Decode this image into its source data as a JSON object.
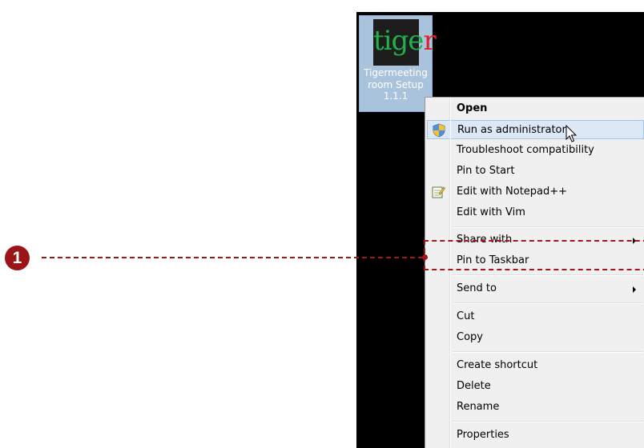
{
  "desktop_icon": {
    "logo_text_part1": "ti",
    "logo_text_part2": "ge",
    "logo_text_part3": "r",
    "caption_line1": "Tigermeeting",
    "caption_line2": "room Setup",
    "caption_line3": "1.1.1"
  },
  "context_menu": {
    "items": [
      {
        "label": "Open"
      },
      {
        "label": "Run as administrator",
        "icon": "uac-shield-icon"
      },
      {
        "label": "Troubleshoot compatibility"
      },
      {
        "label": "Pin to Start"
      },
      {
        "label": "Edit with Notepad++",
        "icon": "notepad-plus-plus-icon"
      },
      {
        "label": "Edit with Vim"
      },
      {
        "label": "Share with",
        "submenu": true
      },
      {
        "label": "Pin to Taskbar"
      },
      {
        "label": "Send to",
        "submenu": true
      },
      {
        "label": "Cut"
      },
      {
        "label": "Copy"
      },
      {
        "label": "Create shortcut"
      },
      {
        "label": "Delete"
      },
      {
        "label": "Rename"
      },
      {
        "label": "Properties"
      }
    ]
  },
  "annotation": {
    "callout_number": "1",
    "color": "#a1151b"
  },
  "colors": {
    "desktop_bg": "#000000",
    "menu_bg": "#f0f0f0",
    "highlight_bg": "#dce8f6",
    "selected_tile": "#a9c3dd"
  }
}
